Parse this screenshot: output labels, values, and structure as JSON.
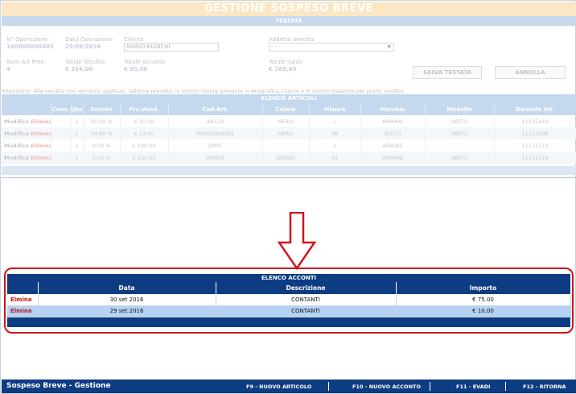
{
  "window": {
    "title": "GESTIONE SOSPESO BREVE",
    "section": "TESTATA"
  },
  "header_fields": {
    "num_operazione": {
      "label": "N° Operazione",
      "value": "160000000405"
    },
    "data_operazione": {
      "label": "Data Operazione",
      "value": "29/09/2016"
    },
    "cliente": {
      "label": "Cliente",
      "value": "MARIO BIANCHI"
    },
    "addetto": {
      "label": "Addetto Vendita",
      "value": "- - -"
    },
    "num_art": {
      "label": "Num Art Pren.",
      "value": "4"
    },
    "totale_vendita": {
      "label": "Totale Vendita",
      "value": "€ 354,00"
    },
    "totale_acconto": {
      "label": "Totale Acconto",
      "value": "€ 85,00"
    },
    "totale_saldo": {
      "label": "Totale Saldo",
      "value": "€ 269,00"
    }
  },
  "buttons": {
    "salva": "SALVA TESTATA",
    "annulla": "ANNULLA"
  },
  "notice": "Attenzione! Alla vendita non verranno applicati, laddove previsto, lo sconto cliente presente in Anagrafica Cliente e lo sconto massimo per punto vendita.",
  "articoli": {
    "title": "ELENCO ARTICOLI",
    "columns": [
      "",
      "Cons.",
      "Qta",
      "Sconto",
      "Prz.Vend.",
      "Cod.Art.",
      "Colore",
      "Misura",
      "Marchio",
      "Modello",
      "Barcode Int."
    ],
    "rows": [
      {
        "modifica": "Modifica",
        "elimina": "Elimina",
        "qta": "1",
        "sconto": "50.00 %",
        "prezzo": "€ 10.00",
        "cod": "AB123",
        "colore": "NERO",
        "misura": "L",
        "marchio": "ARMANI",
        "modello": "ABITO",
        "barcode": "11115443"
      },
      {
        "modifica": "Modifica",
        "elimina": "Elimina",
        "qta": "1",
        "sconto": "34.99 %",
        "prezzo": "€ 13.00",
        "cod": "PROGGIENO01",
        "colore": "NERO",
        "misura": "38",
        "marchio": "GUCCI",
        "modello": "ABITO",
        "barcode": "11112268"
      },
      {
        "modifica": "Modifica",
        "elimina": "Elimina",
        "qta": "1",
        "sconto": "0.00 %",
        "prezzo": "€ 100.00",
        "cod": "DPPS",
        "colore": "",
        "misura": "1",
        "marchio": "ADIDAS",
        "modello": "",
        "barcode": "11112172"
      },
      {
        "modifica": "Modifica",
        "elimina": "Elimina",
        "qta": "1",
        "sconto": "0.00 %",
        "prezzo": "€ 231.00",
        "cod": "ARM01",
        "colore": "GRIGIO",
        "misura": "54",
        "marchio": "ARMANI",
        "modello": "ABITO",
        "barcode": "11111119"
      }
    ]
  },
  "acconti": {
    "title": "ELENCO ACCONTI",
    "columns": [
      "",
      "Data",
      "Descrizione",
      "Importo"
    ],
    "rows": [
      {
        "azione": "Elmina",
        "data": "30 set 2016",
        "descrizione": "CONTANTI",
        "importo": "€ 75.00"
      },
      {
        "azione": "Elmina",
        "data": "29 set 2016",
        "descrizione": "CONTANTI",
        "importo": "€ 10.00"
      }
    ]
  },
  "footer": {
    "title": "Sospeso Breve - Gestione",
    "keys": [
      "F9 - NUOVO ARTICOLO",
      "F10 - NUOVO ACCONTO",
      "F11 - EVADI",
      "F12 - RITORNA"
    ]
  },
  "colors": {
    "navy": "#0e3c82",
    "faded_blue": "#c6d8ee",
    "accent_red": "#d0141a",
    "title_orange": "#fbe7c4"
  },
  "icons": {
    "arrow": "down-arrow-icon",
    "select": "chevron-down-icon"
  }
}
